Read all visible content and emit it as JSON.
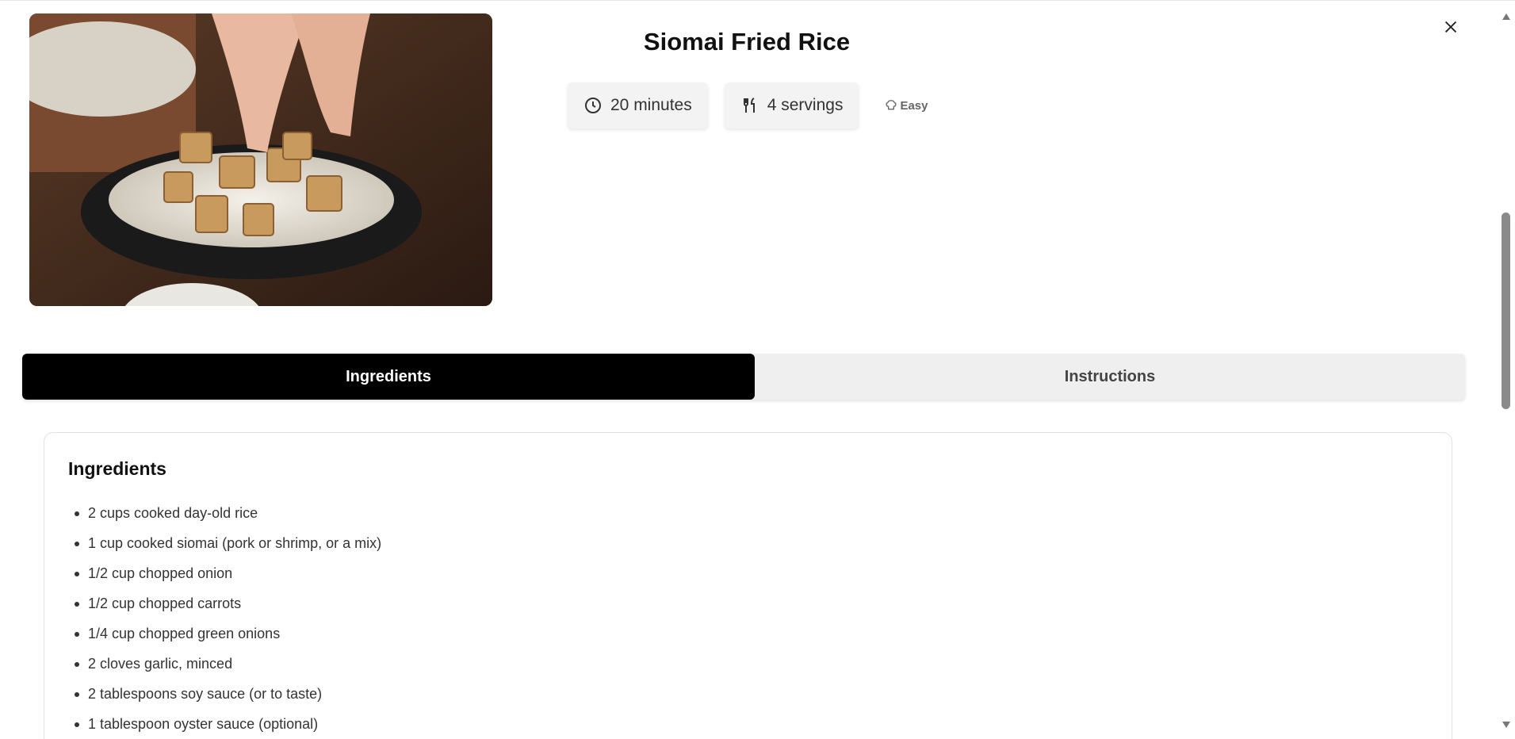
{
  "recipe": {
    "title": "Siomai Fried Rice",
    "time": "20 minutes",
    "servings": "4 servings",
    "difficulty": "Easy",
    "image_alt": "Hand placing fried siomai cubes onto rice in a black pan"
  },
  "icons": {
    "time": "clock-icon",
    "servings": "fork-knife-icon",
    "difficulty": "chef-hat-icon",
    "close": "close-icon"
  },
  "tabs": [
    {
      "label": "Ingredients",
      "active": true
    },
    {
      "label": "Instructions",
      "active": false
    }
  ],
  "ingredients": {
    "heading": "Ingredients",
    "items": [
      "2 cups cooked day-old rice",
      "1 cup cooked siomai (pork or shrimp, or a mix)",
      "1/2 cup chopped onion",
      "1/2 cup chopped carrots",
      "1/4 cup chopped green onions",
      "2 cloves garlic, minced",
      "2 tablespoons soy sauce (or to taste)",
      "1 tablespoon oyster sauce (optional)"
    ]
  },
  "colors": {
    "active_tab_bg": "#000000",
    "inactive_tab_bg": "#efefef",
    "chip_bg": "#f3f3f3"
  }
}
